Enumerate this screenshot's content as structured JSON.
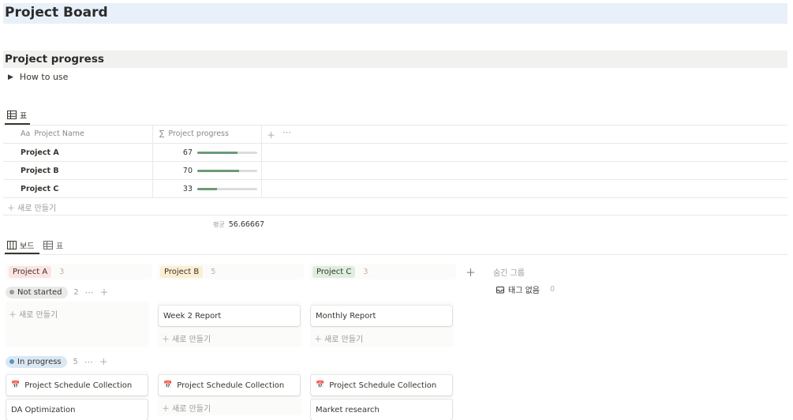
{
  "page": {
    "title": "Project Board"
  },
  "section": {
    "title": "Project progress"
  },
  "toggle": {
    "label": "How to use"
  },
  "table_view": {
    "tab_label": "표",
    "col_name_prefix": "Aa",
    "col_name": "Project Name",
    "col_progress_prefix": "∑",
    "col_progress": "Project progress",
    "rows": [
      {
        "name": "Project A",
        "progress": 67
      },
      {
        "name": "Project B",
        "progress": 70
      },
      {
        "name": "Project C",
        "progress": 33
      }
    ],
    "new_label": "새로 만들기",
    "average_label": "평균",
    "average_value": "56.66667"
  },
  "board_view": {
    "tabs": [
      {
        "label": "보드"
      },
      {
        "label": "표"
      }
    ],
    "groups": [
      {
        "label": "Project A",
        "count": "3",
        "color": "#fde4e2"
      },
      {
        "label": "Project B",
        "count": "5",
        "color": "#fbeed2"
      },
      {
        "label": "Project C",
        "count": "3",
        "color": "#ddeedd"
      }
    ],
    "hidden_groups_label": "숨긴 그룹",
    "no_tag_label": "태그 없음",
    "no_tag_count": "0",
    "new_label": "새로 만들기",
    "subgroups": [
      {
        "label": "Not started",
        "count": "2"
      },
      {
        "label": "In progress",
        "count": "5"
      }
    ],
    "not_started_cards": {
      "b": "Week 2 Report",
      "c": "Monthly Report"
    },
    "in_progress_cards": {
      "a": [
        "Project Schedule Collection",
        "DA Optimization"
      ],
      "b": [
        "Project Schedule Collection"
      ],
      "c": [
        "Project Schedule Collection",
        "Market research"
      ]
    }
  }
}
